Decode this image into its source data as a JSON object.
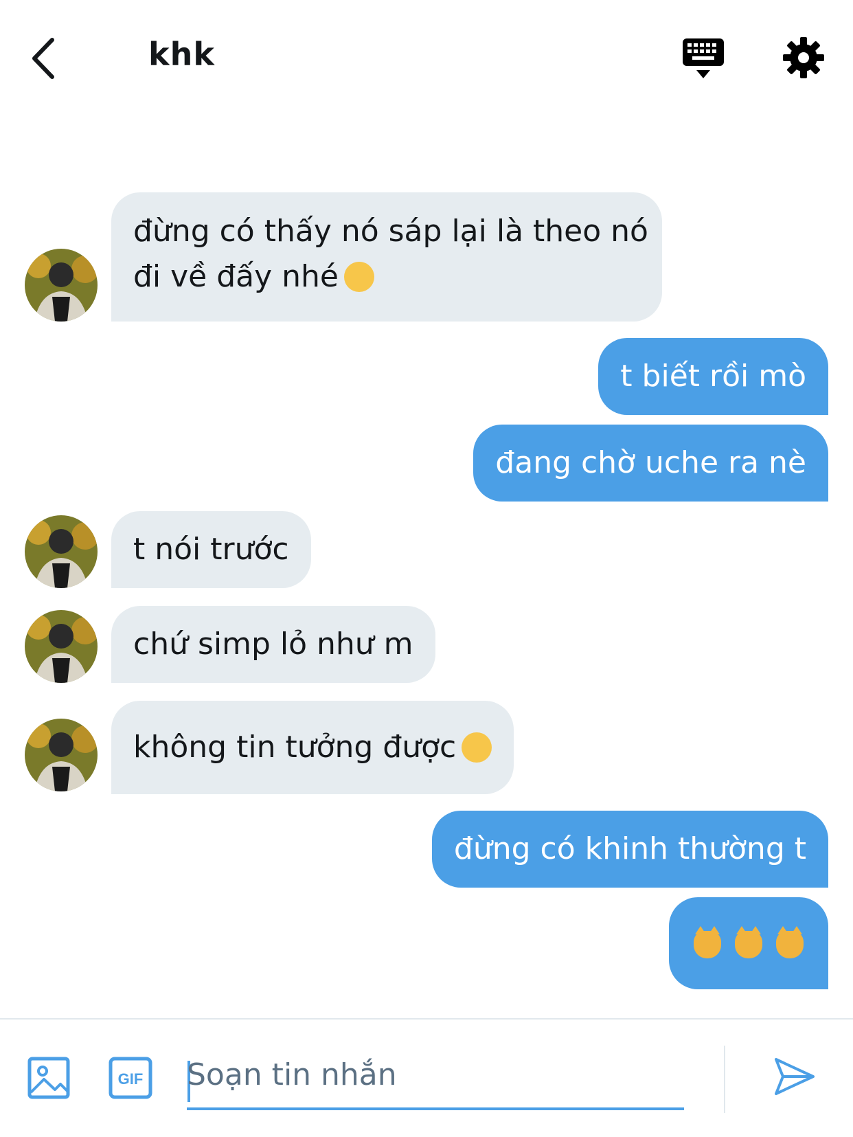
{
  "header": {
    "title": "khk",
    "back_icon": "chevron-left-icon",
    "keyboard_icon": "keyboard-icon",
    "settings_icon": "gear-icon"
  },
  "messages": [
    {
      "side": "in",
      "lines": [
        "đừng có thấy nó sáp lại là theo nó",
        "đi về đấy nhé"
      ],
      "emoji": "slightly-smiling-face"
    },
    {
      "side": "out",
      "text": "t biết rồi mò"
    },
    {
      "side": "out",
      "text": "đang chờ uche ra nè"
    },
    {
      "side": "in",
      "text": "t nói trước"
    },
    {
      "side": "in",
      "text": "chứ simp lỏ như m"
    },
    {
      "side": "in",
      "text": "không tin tưởng được",
      "emoji": "hugging-face"
    },
    {
      "side": "out",
      "text": "đừng có khinh thường t"
    },
    {
      "side": "out",
      "emoji": "pouting-cat-face x3"
    }
  ],
  "composer": {
    "placeholder": "Soạn tin nhắn",
    "gif_label": "GIF"
  },
  "colors": {
    "accent": "#4b9fe6",
    "incoming_bubble": "#e6ecf0",
    "text": "#14171a"
  }
}
